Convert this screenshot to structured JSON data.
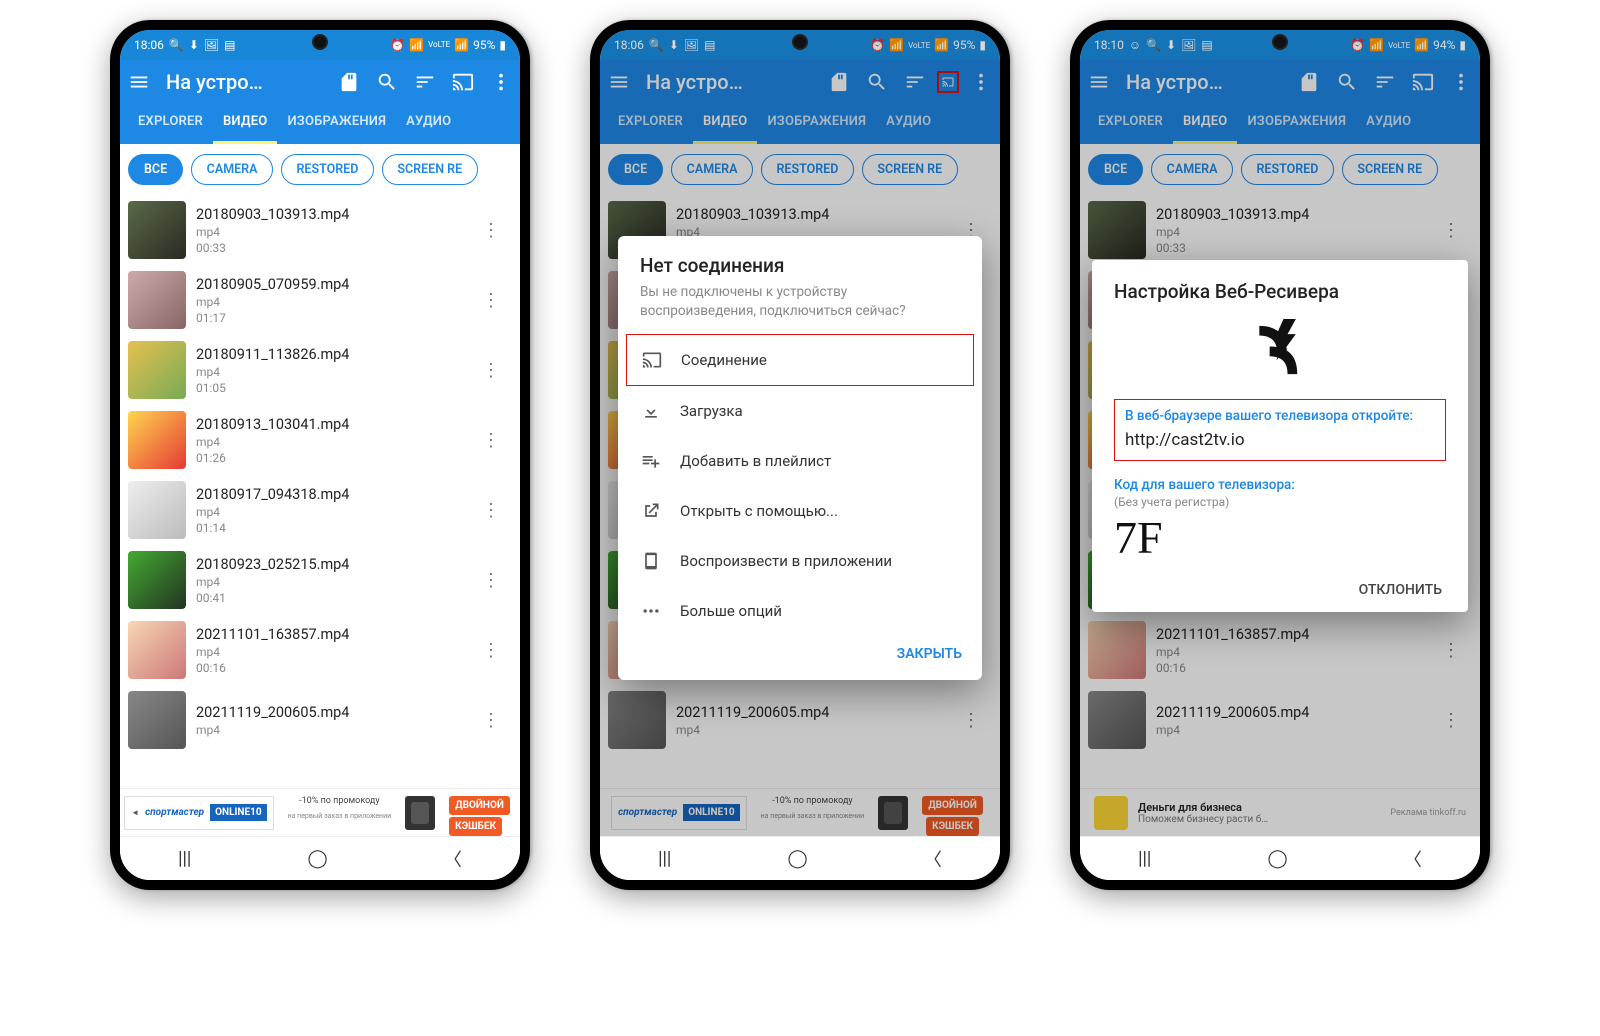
{
  "statusbar": {
    "time1": "18:06",
    "time3": "18:10",
    "battery1": "95%",
    "battery3": "94%"
  },
  "appbar": {
    "title": "На устро…",
    "tabs": {
      "explorer": "EXPLORER",
      "video": "ВИДЕО",
      "images": "ИЗОБРАЖЕНИЯ",
      "audio": "АУДИО"
    }
  },
  "chips": {
    "all": "ВСЕ",
    "camera": "CAMERA",
    "restored": "RESTORED",
    "screenrec": "SCREEN RE"
  },
  "files": [
    {
      "name": "20180903_103913.mp4",
      "ext": "mp4",
      "dur": "00:33",
      "thumb": "t0"
    },
    {
      "name": "20180905_070959.mp4",
      "ext": "mp4",
      "dur": "01:17",
      "thumb": "t1"
    },
    {
      "name": "20180911_113826.mp4",
      "ext": "mp4",
      "dur": "01:05",
      "thumb": "t2"
    },
    {
      "name": "20180913_103041.mp4",
      "ext": "mp4",
      "dur": "01:26",
      "thumb": "t3"
    },
    {
      "name": "20180917_094318.mp4",
      "ext": "mp4",
      "dur": "01:14",
      "thumb": "t4"
    },
    {
      "name": "20180923_025215.mp4",
      "ext": "mp4",
      "dur": "00:41",
      "thumb": "t5"
    },
    {
      "name": "20211101_163857.mp4",
      "ext": "mp4",
      "dur": "00:16",
      "thumb": "t6"
    },
    {
      "name": "20211119_200605.mp4",
      "ext": "mp4",
      "dur": "",
      "thumb": "t7"
    }
  ],
  "ad1": {
    "promo": "-10% по промокоду",
    "brand": "спортмастер",
    "code": "ONLINE10",
    "sub": "на первый заказ в приложении",
    "badge1": "ДВОЙНОЙ",
    "badge2": "КЭШБЕК"
  },
  "ad3": {
    "title": "Деньги для бизнеса",
    "sub": "Поможем бизнесу расти б…",
    "src": "Реклама tinkoff.ru"
  },
  "dialog2": {
    "title": "Нет соединения",
    "sub": "Вы не подключены к устройству воспроизведения, подключиться сейчас?",
    "connect": "Соединение",
    "download": "Загрузка",
    "playlist": "Добавить в плейлист",
    "openwith": "Открыть с помощью...",
    "playinapp": "Воспроизвести в приложении",
    "more": "Больше опций",
    "close": "ЗАКРЫТЬ"
  },
  "dialog3": {
    "title": "Настройка Веб-Ресивера",
    "instr": "В веб-браузере вашего телевизора откройте:",
    "url": "http://cast2tv.io",
    "codelabel": "Код для вашего телевизора:",
    "codehint": "(Без учета регистра)",
    "code": "7F",
    "dismiss": "ОТКЛОНИТЬ"
  }
}
